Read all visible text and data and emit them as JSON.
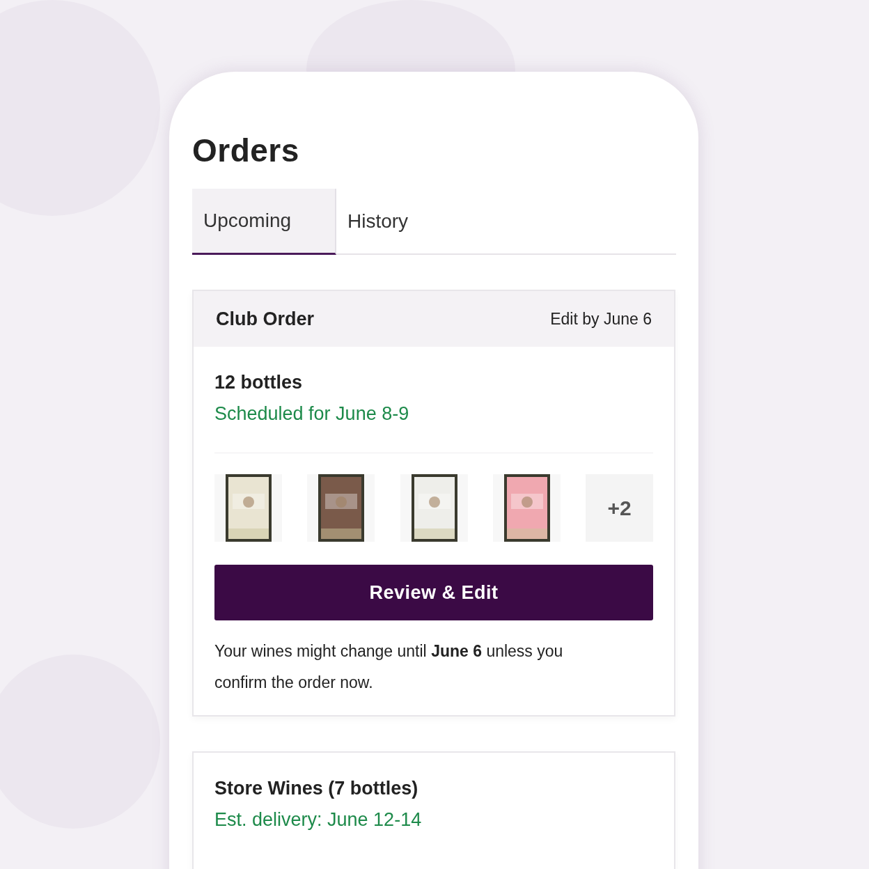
{
  "title": "Orders",
  "tabs": [
    {
      "label": "Upcoming",
      "selected": true
    },
    {
      "label": "History",
      "selected": false
    }
  ],
  "club_order": {
    "title": "Club Order",
    "edit_by": "Edit by June 6",
    "bottles": "12 bottles",
    "schedule": "Scheduled for June 8-9",
    "thumbnails": [
      {
        "kind": "picture",
        "color": "#e9e4d2"
      },
      {
        "kind": "picture",
        "color": "#7a5a4a"
      },
      {
        "kind": "picture",
        "color": "#eeeeea"
      },
      {
        "kind": "picture",
        "color": "#f0a8b0"
      },
      {
        "kind": "more",
        "label": "+2"
      }
    ],
    "button": "Review & Edit",
    "note": "Your wines might change until **June 6** unless you confirm the order now."
  },
  "store_order": {
    "title": "Store Wines (7 bottles)",
    "delivery": "Est. delivery: June 12-14"
  }
}
